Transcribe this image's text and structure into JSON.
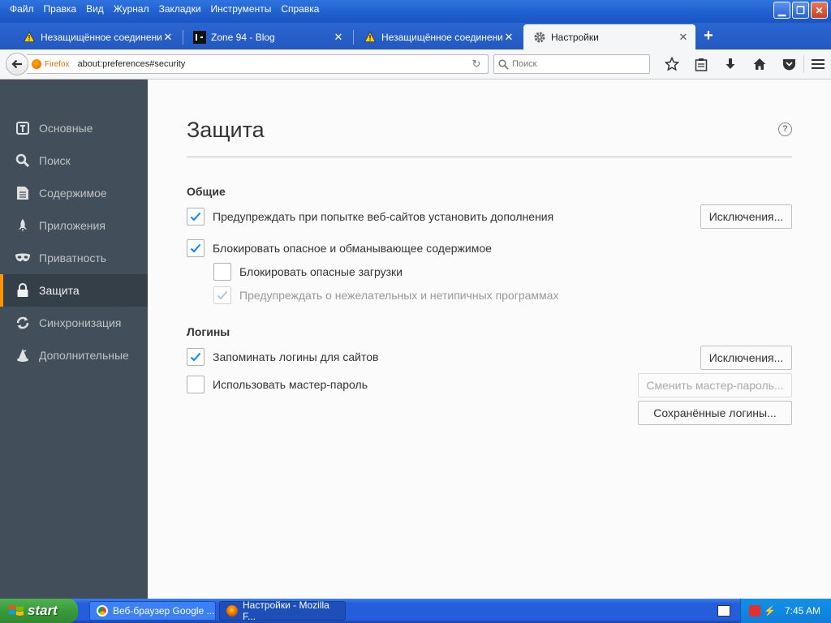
{
  "menu": [
    "Файл",
    "Правка",
    "Вид",
    "Журнал",
    "Закладки",
    "Инструменты",
    "Справка"
  ],
  "tabs": [
    {
      "label": "Незащищённое соединение",
      "icon": "warning-icon",
      "active": false
    },
    {
      "label": "Zone 94 - Blog",
      "icon": "site-favicon",
      "active": false
    },
    {
      "label": "Незащищённое соединение",
      "icon": "warning-icon",
      "active": false
    },
    {
      "label": "Настройки",
      "icon": "gear-icon",
      "active": true
    }
  ],
  "navbar": {
    "identity_label": "Firefox",
    "url": "about:preferences#security",
    "search_placeholder": "Поиск"
  },
  "sidebar": {
    "items": [
      {
        "label": "Основные",
        "icon": "general-icon"
      },
      {
        "label": "Поиск",
        "icon": "search-icon"
      },
      {
        "label": "Содержимое",
        "icon": "content-icon"
      },
      {
        "label": "Приложения",
        "icon": "applications-icon"
      },
      {
        "label": "Приватность",
        "icon": "privacy-mask-icon"
      },
      {
        "label": "Защита",
        "icon": "security-lock-icon",
        "selected": true
      },
      {
        "label": "Синхронизация",
        "icon": "sync-icon"
      },
      {
        "label": "Дополнительные",
        "icon": "advanced-icon"
      }
    ]
  },
  "page": {
    "title": "Защита",
    "general": {
      "heading": "Общие",
      "warn_addons": {
        "label": "Предупреждать при попытке веб-сайтов установить дополнения",
        "checked": true
      },
      "exceptions_button": "Исключения...",
      "block_dangerous": {
        "label": "Блокировать опасное и обманывающее содержимое",
        "checked": true
      },
      "block_downloads": {
        "label": "Блокировать опасные загрузки",
        "checked": false
      },
      "warn_unwanted": {
        "label": "Предупреждать о нежелательных и нетипичных программах",
        "checked": true,
        "disabled": true
      }
    },
    "logins": {
      "heading": "Логины",
      "remember": {
        "label": "Запоминать логины для сайтов",
        "checked": true
      },
      "exceptions_button": "Исключения...",
      "master_password": {
        "label": "Использовать мастер-пароль",
        "checked": false
      },
      "change_master_button": "Сменить мастер-пароль...",
      "saved_logins_button": "Сохранённые логины..."
    }
  },
  "taskbar": {
    "start_label": "start",
    "tasks": [
      {
        "label": "Веб-браузер Google ...",
        "pressed": false
      },
      {
        "label": "Настройки - Mozilla F...",
        "pressed": true
      }
    ],
    "clock": "7:45 AM"
  },
  "colors": {
    "sidebar_bg": "#424f5a",
    "sidebar_selected_bg": "#343f48",
    "selected_accent": "#ff9500",
    "checkmark": "#0a84ff",
    "xp_blue": "#245edb"
  }
}
